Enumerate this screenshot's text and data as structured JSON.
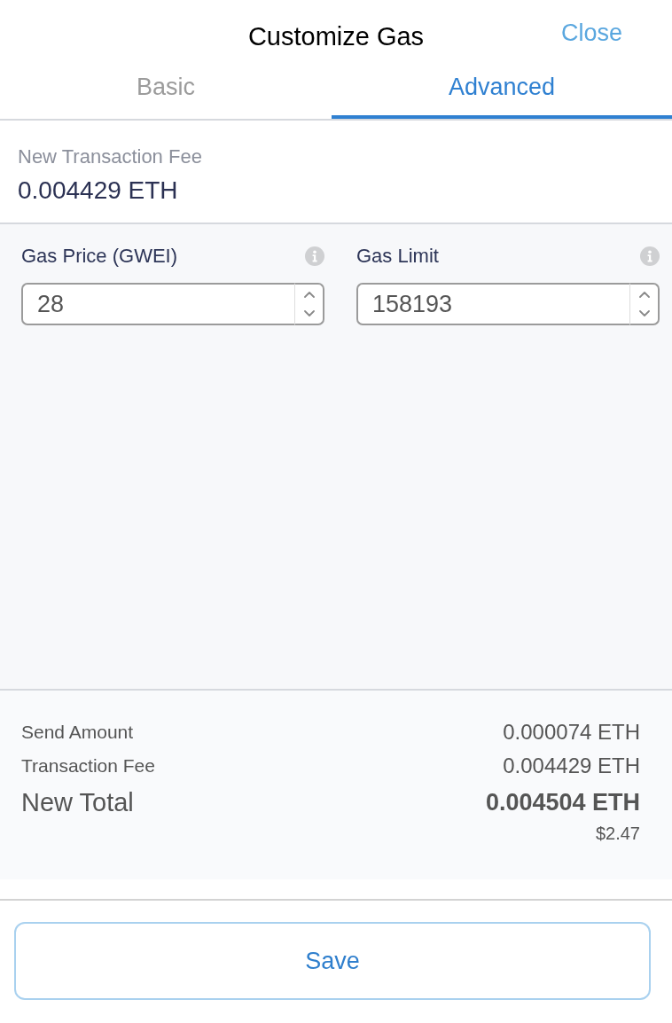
{
  "header": {
    "title": "Customize Gas",
    "close_label": "Close"
  },
  "tabs": [
    {
      "label": "Basic",
      "selected": false
    },
    {
      "label": "Advanced",
      "selected": true
    }
  ],
  "fee": {
    "label": "New Transaction Fee",
    "value": "0.004429 ETH"
  },
  "fields": [
    {
      "label": "Gas Price (GWEI)",
      "value": "28"
    },
    {
      "label": "Gas Limit",
      "value": "158193"
    }
  ],
  "summary": {
    "rows": [
      {
        "kind": "normal",
        "label": "Send Amount",
        "value": "0.000074 ETH"
      },
      {
        "kind": "normal",
        "label": "Transaction Fee",
        "value": "0.004429 ETH"
      },
      {
        "kind": "total",
        "label": "New Total",
        "value": "0.004504 ETH",
        "subvalue": "$2.47"
      }
    ]
  },
  "save_label": "Save"
}
